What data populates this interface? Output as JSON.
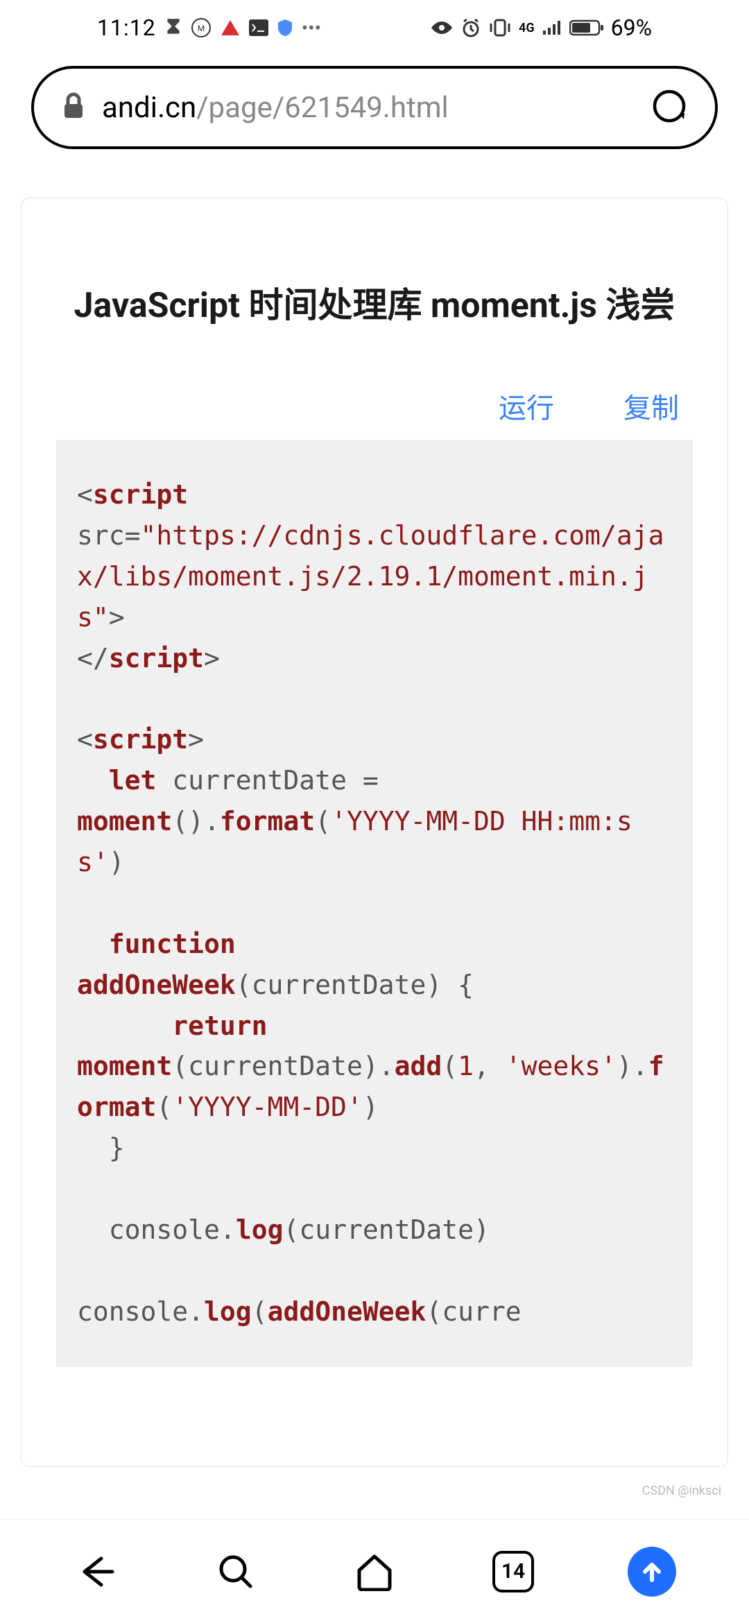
{
  "status": {
    "time": "11:12",
    "battery": "69%",
    "net": "4G"
  },
  "url": {
    "host": "andi.cn",
    "path": "/page/621549.html"
  },
  "article": {
    "title": "JavaScript 时间处理库 moment.js 浅尝"
  },
  "codeActions": {
    "run": "运行",
    "copy": "复制"
  },
  "code": {
    "line1_open": "<",
    "line1_tag": "script",
    "line2_attr": "src=",
    "line2_val": "\"https://cdnjs.cloudflare.com/ajax/libs/moment.js/2.19.1/moment.min.js\"",
    "line2_close": ">",
    "line3_open": "</",
    "line3_tag": "script",
    "line3_close": ">",
    "line5_open": "<",
    "line5_tag": "script",
    "line5_close": ">",
    "line6_kw": "let",
    "line6_rest": " currentDate = ",
    "line7_fn1": "moment",
    "line7_p1": "().",
    "line7_fn2": "format",
    "line7_p2": "(",
    "line7_str": "'YYYY-MM-DD HH:mm:ss'",
    "line7_p3": ")",
    "line9_kw": "function",
    "line10_fn": "addOneWeek",
    "line10_rest": "(currentDate) {",
    "line11_kw": "return",
    "line12_fn1": "moment",
    "line12_p1": "(currentDate).",
    "line12_fn2": "add",
    "line12_p2": "(",
    "line12_n": "1",
    "line12_p3": ", ",
    "line12_str1": "'weeks'",
    "line12_p4": ").",
    "line12_fn3": "format",
    "line12_p5": "(",
    "line12_str2": "'YYYY-MM-DD'",
    "line12_p6": ")",
    "line13": "  }",
    "line15_obj": "console",
    "line15_dot": ".",
    "line15_fn": "log",
    "line15_rest": "(currentDate)",
    "line17_obj": "console",
    "line17_dot": ".",
    "line17_fn": "log",
    "line17_p1": "(",
    "line17_fn2": "addOneWeek",
    "line17_rest": "(curre"
  },
  "nav": {
    "tabs": "14"
  },
  "watermark": "CSDN @inksci"
}
